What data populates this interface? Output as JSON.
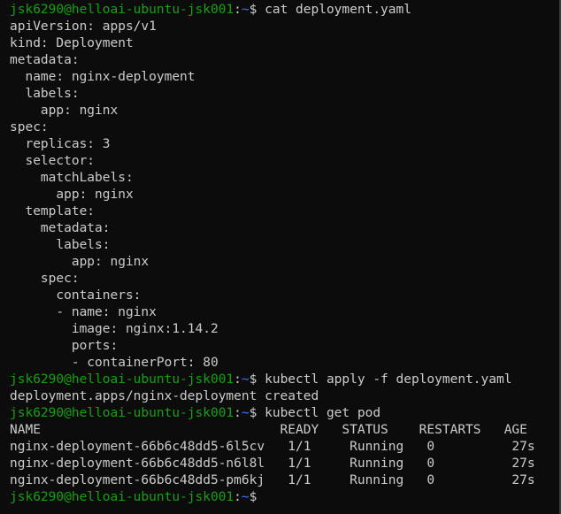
{
  "prompt": {
    "user_host": "jsk6290@helloai-ubuntu-jsk001",
    "sep": ":",
    "path": "~",
    "symbol": "$ "
  },
  "commands": {
    "cat": "cat deployment.yaml",
    "apply": "kubectl apply -f deployment.yaml",
    "get": "kubectl get pod"
  },
  "yaml": [
    "apiVersion: apps/v1",
    "kind: Deployment",
    "metadata:",
    "  name: nginx-deployment",
    "  labels:",
    "    app: nginx",
    "spec:",
    "  replicas: 3",
    "  selector:",
    "    matchLabels:",
    "      app: nginx",
    "  template:",
    "    metadata:",
    "      labels:",
    "        app: nginx",
    "    spec:",
    "      containers:",
    "      - name: nginx",
    "        image: nginx:1.14.2",
    "        ports:",
    "        - containerPort: 80"
  ],
  "apply_output": "deployment.apps/nginx-deployment created",
  "pods_table": {
    "header": "NAME                               READY   STATUS    RESTARTS   AGE",
    "rows": [
      "nginx-deployment-66b6c48dd5-6l5cv   1/1     Running   0          27s",
      "nginx-deployment-66b6c48dd5-n6l8l   1/1     Running   0          27s",
      "nginx-deployment-66b6c48dd5-pm6kj   1/1     Running   0          27s"
    ]
  }
}
